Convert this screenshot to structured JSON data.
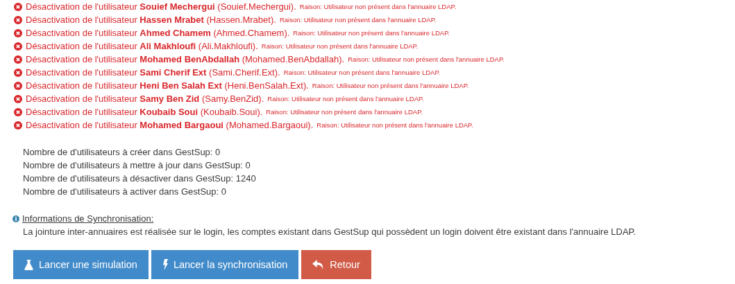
{
  "messages": [
    {
      "text": "Désactivation de l'utilisateur **Souief Mechergui** (Souief.Mechergui).",
      "reason": "Raison: Utilisateur non présent dans l'annuaire LDAP."
    },
    {
      "text": "Désactivation de l'utilisateur **Hassen Mrabet** (Hassen.Mrabet).",
      "reason": "Raison: Utilisateur non présent dans l'annuaire LDAP."
    },
    {
      "text": "Désactivation de l'utilisateur **Ahmed Chamem** (Ahmed.Chamem).",
      "reason": "Raison: Utilisateur non présent dans l'annuaire LDAP."
    },
    {
      "text": "Désactivation de l'utilisateur **Ali Makhloufi** (Ali.Makhloufi).",
      "reason": "Raison: Utilisateur non présent dans l'annuaire LDAP."
    },
    {
      "text": "Désactivation de l'utilisateur **Mohamed BenAbdallah** (Mohamed.BenAbdallah).",
      "reason": "Raison: Utilisateur non présent dans l'annuaire LDAP."
    },
    {
      "text": "Désactivation de l'utilisateur **Sami Cherif Ext** (Sami.Cherif.Ext).",
      "reason": "Raison: Utilisateur non présent dans l'annuaire LDAP."
    },
    {
      "text": "Désactivation de l'utilisateur **Heni Ben Salah Ext** (Heni.BenSalah.Ext).",
      "reason": "Raison: Utilisateur non présent dans l'annuaire LDAP."
    },
    {
      "text": "Désactivation de l'utilisateur **Samy Ben Zid** (Samy.BenZid).",
      "reason": "Raison: Utilisateur non présent dans l'annuaire LDAP."
    },
    {
      "text": "Désactivation de l'utilisateur **Koubaib Soui** (Koubaib.Soui).",
      "reason": "Raison: Utilisateur non présent dans l'annuaire LDAP."
    },
    {
      "text": "Désactivation de l'utilisateur **Mohamed Bargaoui** (Mohamed.Bargaoui).",
      "reason": "Raison: Utilisateur non présent dans l'annuaire LDAP."
    }
  ],
  "counts": [
    "Nombre de d'utilisateurs à créer dans GestSup: 0",
    "Nombre de d'utilisateurs à mettre à jour dans GestSup: 0",
    "Nombre de d'utilisateurs à désactiver dans GestSup: 1240",
    "Nombre de d'utilisateurs à activer dans GestSup: 0"
  ],
  "info": {
    "title": "Informations de Synchronisation:",
    "text": "La jointure inter-annuaires est réalisée sur le login, les comptes existant dans GestSup qui possèdent un login doivent être existant dans l'annuaire LDAP."
  },
  "buttons": [
    {
      "kind": "simulate",
      "label": "Lancer une simulation"
    },
    {
      "kind": "sync",
      "label": "Lancer la synchronisation"
    },
    {
      "kind": "back",
      "label": "Retour"
    }
  ]
}
